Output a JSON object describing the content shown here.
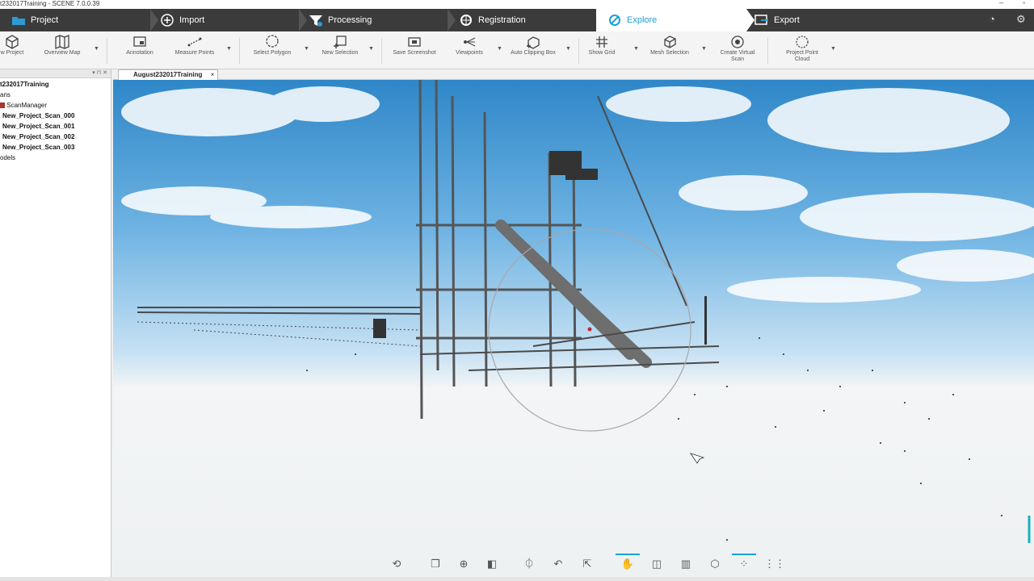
{
  "window": {
    "title": "t232017Training - SCENE 7.0.0.39"
  },
  "workflow_tabs": [
    {
      "label": "Project",
      "icon": "folder-icon"
    },
    {
      "label": "Import",
      "icon": "import-icon"
    },
    {
      "label": "Processing",
      "icon": "funnel-icon"
    },
    {
      "label": "Registration",
      "icon": "registration-icon"
    },
    {
      "label": "Explore",
      "icon": "explore-icon",
      "active": true
    },
    {
      "label": "Export",
      "icon": "export-icon"
    }
  ],
  "toolbar": {
    "items": [
      {
        "label": "w Project",
        "icon": "cube-icon"
      },
      {
        "label": "Overview Map",
        "icon": "map-icon"
      },
      {
        "label": "Annotation",
        "icon": "annotation-icon"
      },
      {
        "label": "Measure Points",
        "icon": "measure-icon"
      },
      {
        "label": "Select Polygon",
        "icon": "polygon-icon"
      },
      {
        "label": "New Selection",
        "icon": "new-selection-icon"
      },
      {
        "label": "Save Screenshot",
        "icon": "camera-icon"
      },
      {
        "label": "Viewpoints",
        "icon": "viewpoints-icon"
      },
      {
        "label": "Auto Clipping Box",
        "icon": "clipping-box-icon"
      },
      {
        "label": "Show Grid",
        "icon": "grid-icon"
      },
      {
        "label": "Mesh Selection",
        "icon": "mesh-icon"
      },
      {
        "label": "Create Virtual Scan",
        "icon": "virtual-scan-icon"
      },
      {
        "label": "Project Point Cloud",
        "icon": "point-cloud-icon"
      }
    ]
  },
  "sidebar": {
    "items": [
      {
        "label": "t232017Training",
        "bold": true
      },
      {
        "label": "ans",
        "bold": false
      },
      {
        "label": "ScanManager",
        "bold": false
      },
      {
        "label": "New_Project_Scan_000",
        "bold": true
      },
      {
        "label": "New_Project_Scan_001",
        "bold": true
      },
      {
        "label": "New_Project_Scan_002",
        "bold": true
      },
      {
        "label": "New_Project_Scan_003",
        "bold": true
      },
      {
        "label": "odels",
        "bold": false
      }
    ]
  },
  "doc_tab": {
    "label": "August232017Training",
    "close": "×"
  },
  "nav_buttons": [
    {
      "icon": "orbit-icon",
      "glyph": "⟲"
    },
    {
      "icon": "walk-icon",
      "glyph": "❐"
    },
    {
      "icon": "zoom-icon",
      "glyph": "⊕"
    },
    {
      "icon": "view-cube-icon",
      "glyph": "◧"
    },
    {
      "icon": "center-icon",
      "glyph": "⏀"
    },
    {
      "icon": "reset-view-icon",
      "glyph": "↶"
    },
    {
      "icon": "fit-icon",
      "glyph": "⇱"
    },
    {
      "icon": "hand-icon",
      "glyph": "✋"
    },
    {
      "icon": "mirror-icon",
      "glyph": "◫"
    },
    {
      "icon": "slice-icon",
      "glyph": "▥"
    },
    {
      "icon": "box-icon",
      "glyph": "⬡"
    },
    {
      "icon": "points-icon",
      "glyph": "⁘"
    },
    {
      "icon": "grid-menu-icon",
      "glyph": "⋮⋮"
    }
  ],
  "colors": {
    "accent": "#1aa0d8",
    "workflow_bg": "#3b3b3b"
  }
}
